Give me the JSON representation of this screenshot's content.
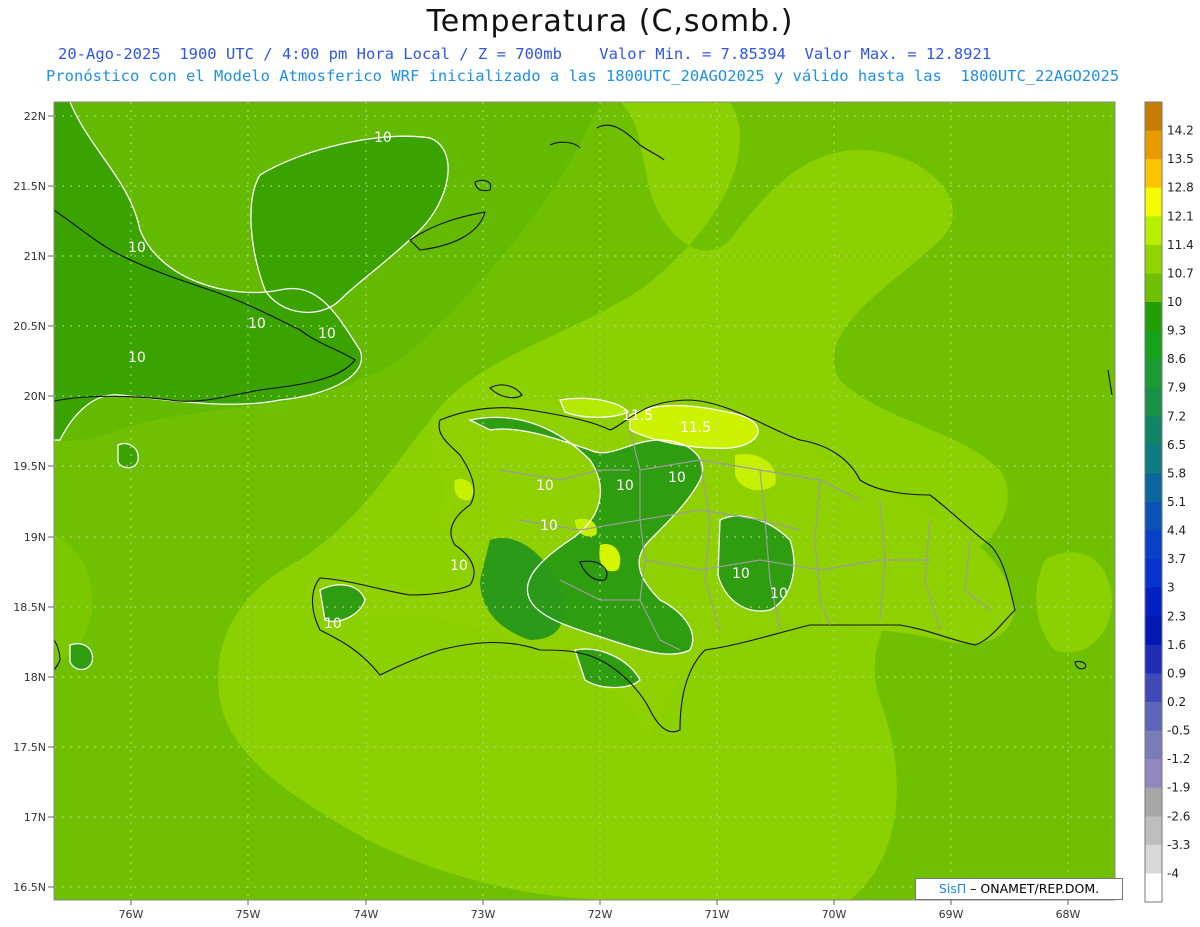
{
  "header": {
    "title": "Temperatura (C,somb.)",
    "line1": "20-Ago-2025  1900 UTC / 4:00 pm Hora Local / Z = 700mb    Valor Min. = 7.85394  Valor Max. = 12.8921",
    "line2": "Pronóstico con el Modelo Atmosferico WRF inicializado a las 1800UTC_20AGO2025 y válido hasta las  1800UTC_22AGO2025"
  },
  "map": {
    "lat_labels": [
      "22N",
      "21.5N",
      "21N",
      "20.5N",
      "20N",
      "19.5N",
      "19N",
      "18.5N",
      "18N",
      "17.5N",
      "17N",
      "16.5N"
    ],
    "lon_labels": [
      "76W",
      "75W",
      "74W",
      "73W",
      "72W",
      "71W",
      "70W",
      "69W",
      "68W"
    ],
    "contour_labels": [
      "10",
      "10",
      "10",
      "10",
      "10",
      "10",
      "10",
      "10",
      "10",
      "10",
      "10",
      "10",
      "10",
      "11.5",
      "11.5"
    ]
  },
  "colorbar": {
    "levels": [
      {
        "label": "14.2",
        "color": "#c47d00"
      },
      {
        "label": "13.5",
        "color": "#e89a00"
      },
      {
        "label": "12.8",
        "color": "#ffc400"
      },
      {
        "label": "12.1",
        "color": "#f4fb00"
      },
      {
        "label": "11.4",
        "color": "#b9f000"
      },
      {
        "label": "10.7",
        "color": "#94d400"
      },
      {
        "label": "10",
        "color": "#6fc000"
      },
      {
        "label": "9.3",
        "color": "#20a000"
      },
      {
        "label": "8.6",
        "color": "#17a21c"
      },
      {
        "label": "7.9",
        "color": "#1c9a34"
      },
      {
        "label": "7.2",
        "color": "#199049"
      },
      {
        "label": "6.5",
        "color": "#128466"
      },
      {
        "label": "5.8",
        "color": "#0e7a82"
      },
      {
        "label": "5.1",
        "color": "#0b669e"
      },
      {
        "label": "4.4",
        "color": "#0a52b6"
      },
      {
        "label": "3.7",
        "color": "#0841c8"
      },
      {
        "label": "3",
        "color": "#0632cf"
      },
      {
        "label": "2.3",
        "color": "#0020c4"
      },
      {
        "label": "1.6",
        "color": "#0018b0"
      },
      {
        "label": "0.9",
        "color": "#1d2db5"
      },
      {
        "label": "0.2",
        "color": "#3f4ab8"
      },
      {
        "label": "-0.5",
        "color": "#5d66b8"
      },
      {
        "label": "-1.2",
        "color": "#7a7cba"
      },
      {
        "label": "-1.9",
        "color": "#9487bf"
      },
      {
        "label": "-2.6",
        "color": "#a7a7a7"
      },
      {
        "label": "-3.3",
        "color": "#bdbdbd"
      },
      {
        "label": "-4",
        "color": "#d9d9d9"
      },
      {
        "label": "",
        "color": "#ffffff"
      }
    ]
  },
  "credit": {
    "brand": "SisΠ",
    "text": " – ONAMET/REP.DOM."
  }
}
